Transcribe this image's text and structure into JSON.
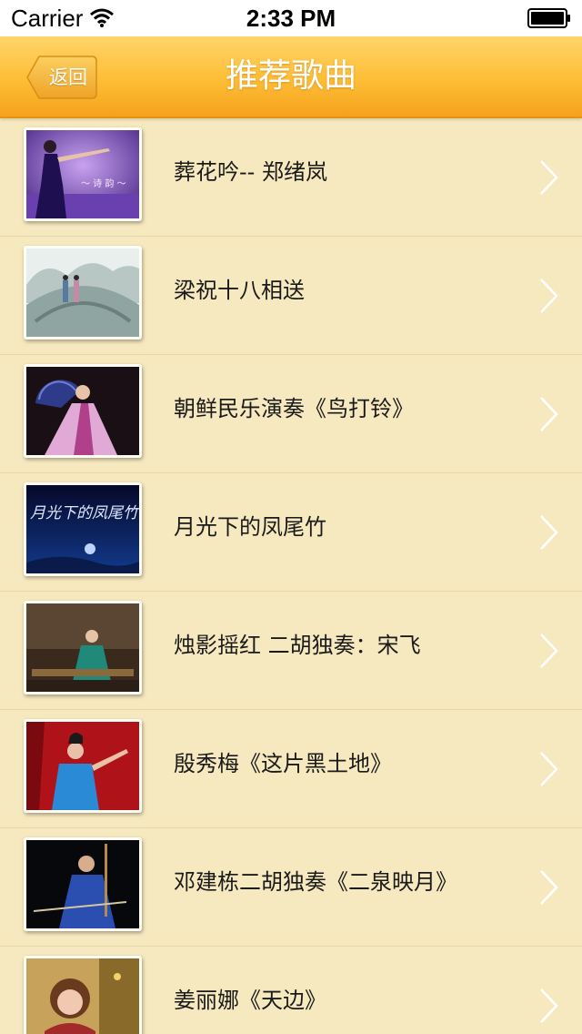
{
  "status_bar": {
    "carrier": "Carrier",
    "time": "2:33 PM",
    "icons": [
      "wifi-icon",
      "battery-icon"
    ]
  },
  "nav": {
    "back_label": "返回",
    "title": "推荐歌曲"
  },
  "colors": {
    "background": "#f7e9bf",
    "nav_gradient_top": "#ffd56a",
    "nav_gradient_bottom": "#f6a21d",
    "text": "#1a1a1a",
    "chevron": "#ffffff"
  },
  "songs": [
    {
      "title": "葬花吟-- 郑绪岚",
      "thumbnail": "singer-on-stage-purple-thumbnail"
    },
    {
      "title": "梁祝十八相送",
      "thumbnail": "painted-landscape-bridge-thumbnail"
    },
    {
      "title": "朝鲜民乐演奏《鸟打铃》",
      "thumbnail": "fan-dancer-thumbnail"
    },
    {
      "title": "月光下的凤尾竹",
      "thumbnail": "moonlit-night-calligraphy-thumbnail"
    },
    {
      "title": "烛影摇红 二胡独奏：宋飞",
      "thumbnail": "erhu-performer-stage-thumbnail"
    },
    {
      "title": "殷秀梅《这片黑土地》",
      "thumbnail": "singer-red-curtain-thumbnail"
    },
    {
      "title": "邓建栋二胡独奏《二泉映月》",
      "thumbnail": "erhu-player-blue-robe-thumbnail"
    },
    {
      "title": "姜丽娜《天边》",
      "thumbnail": "singer-portrait-thumbnail"
    }
  ]
}
